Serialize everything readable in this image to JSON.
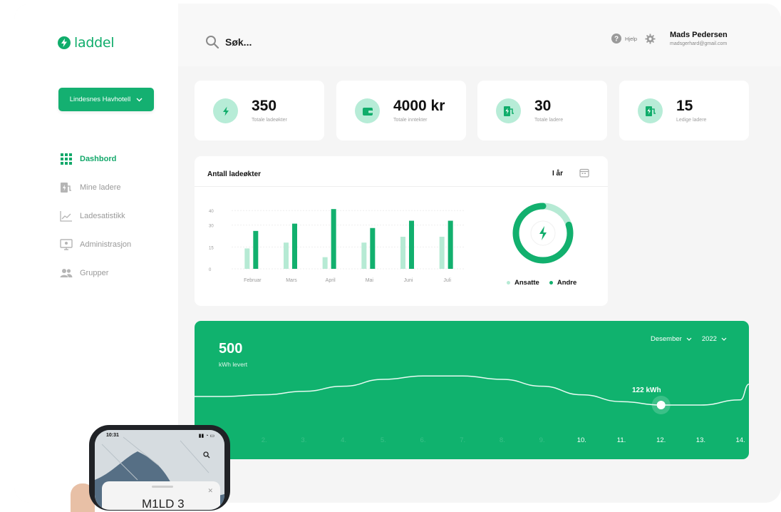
{
  "app": {
    "brand": "laddel",
    "site_selector": "Lindesnes Havhotell"
  },
  "sidebar": {
    "items": [
      {
        "label": "Dashbord",
        "icon": "grid-icon",
        "active": true
      },
      {
        "label": "Mine ladere",
        "icon": "charger-icon",
        "active": false
      },
      {
        "label": "Ladesatistikk",
        "icon": "chart-line-icon",
        "active": false
      },
      {
        "label": "Administrasjon",
        "icon": "monitor-icon",
        "active": false
      },
      {
        "label": "Grupper",
        "icon": "users-icon",
        "active": false
      }
    ]
  },
  "header": {
    "search_placeholder": "Søk...",
    "help_label": "Hjelp",
    "user_name": "Mads Pedersen",
    "user_email": "madsgerhard@gmail.com"
  },
  "stats": [
    {
      "value": "350",
      "label": "Totale ladeøkter",
      "icon": "bolt-icon"
    },
    {
      "value": "4000 kr",
      "label": "Totale inntekter",
      "icon": "wallet-icon"
    },
    {
      "value": "30",
      "label": "Totale ladere",
      "icon": "charger-icon"
    },
    {
      "value": "15",
      "label": "Ledige ladere",
      "icon": "charger-icon"
    }
  ],
  "sessions_card": {
    "title": "Antall ladeøkter",
    "period": "I år"
  },
  "chart_data": [
    {
      "type": "bar",
      "title": "Antall ladeøkter",
      "categories": [
        "Februar",
        "Mars",
        "April",
        "Mai",
        "Juni",
        "Juli"
      ],
      "series": [
        {
          "name": "Ansatte",
          "values": [
            14,
            18,
            8,
            18,
            22,
            22
          ]
        },
        {
          "name": "Andre",
          "values": [
            26,
            31,
            41,
            28,
            33,
            33
          ]
        }
      ],
      "y_ticks": [
        "0",
        "15",
        "30",
        "40"
      ],
      "ylim": [
        0,
        45
      ],
      "grid": true,
      "colors": {
        "Ansatte": "#b6ead4",
        "Andre": "#12b06e"
      }
    },
    {
      "type": "pie",
      "style": "donut",
      "series": [
        {
          "name": "Ansatte",
          "values": [
            20
          ]
        },
        {
          "name": "Andre",
          "values": [
            80
          ]
        }
      ],
      "legend": [
        "Ansatte",
        "Andre"
      ]
    },
    {
      "type": "line",
      "title": "",
      "headline_value": "500",
      "headline_label": "kWh levert",
      "x": [
        "1.",
        "2.",
        "3.",
        "4.",
        "5.",
        "6.",
        "7.",
        "8.",
        "9.",
        "10.",
        "11.",
        "12.",
        "13.",
        "14."
      ],
      "visible_tick_labels": [
        "10.",
        "11.",
        "12.",
        "13.",
        "14."
      ],
      "y": [
        100,
        101,
        103,
        106,
        110,
        112,
        112,
        110,
        106,
        101,
        97,
        95,
        95,
        98
      ],
      "highlight": {
        "x": "12.",
        "label": "122 kWh"
      }
    }
  ],
  "energy_card": {
    "value": "500",
    "unit_label": "kWh levert",
    "month": "Desember",
    "year": "2022",
    "callout": "122 kWh"
  },
  "phone": {
    "time": "10:31",
    "title": "M1LD 3"
  },
  "colors": {
    "brand": "#10ad6b",
    "brand_light": "#b6ead4",
    "background": "#f5f5f5"
  }
}
